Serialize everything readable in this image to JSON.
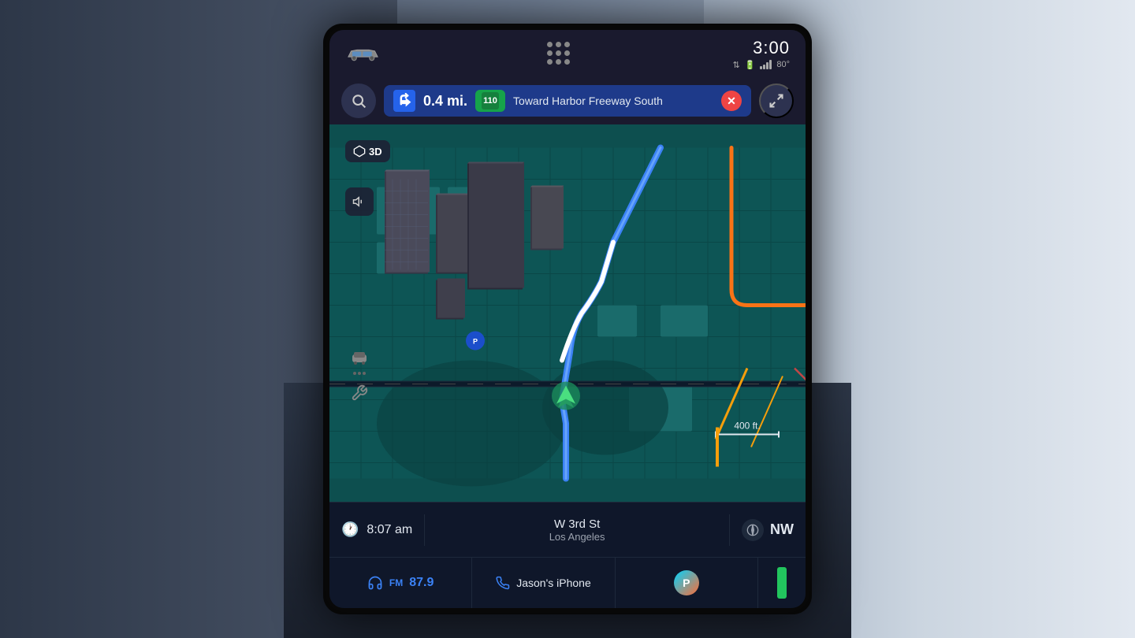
{
  "statusBar": {
    "time": "3:00",
    "temperature": "80°",
    "signalBars": 4
  },
  "navBar": {
    "searchLabel": "Search",
    "distance": "0.4 mi.",
    "highwayNumber": "110",
    "destination": "Toward Harbor Freeway South",
    "expandLabel": "Expand"
  },
  "mapControls": {
    "threeDLabel": "3D",
    "soundLabel": "Sound",
    "scaleLabel": "400 ft.",
    "vehicleLabel": "Vehicle",
    "toolsLabel": "Tools"
  },
  "bottomInfo": {
    "time": "8:07 am",
    "street": "W 3rd St",
    "city": "Los Angeles",
    "direction": "NW"
  },
  "appBar": {
    "radioType": "FM",
    "frequency": "87.9",
    "phoneName": "Jason's iPhone",
    "pandoraLabel": "Pandora",
    "indicators": "●"
  }
}
